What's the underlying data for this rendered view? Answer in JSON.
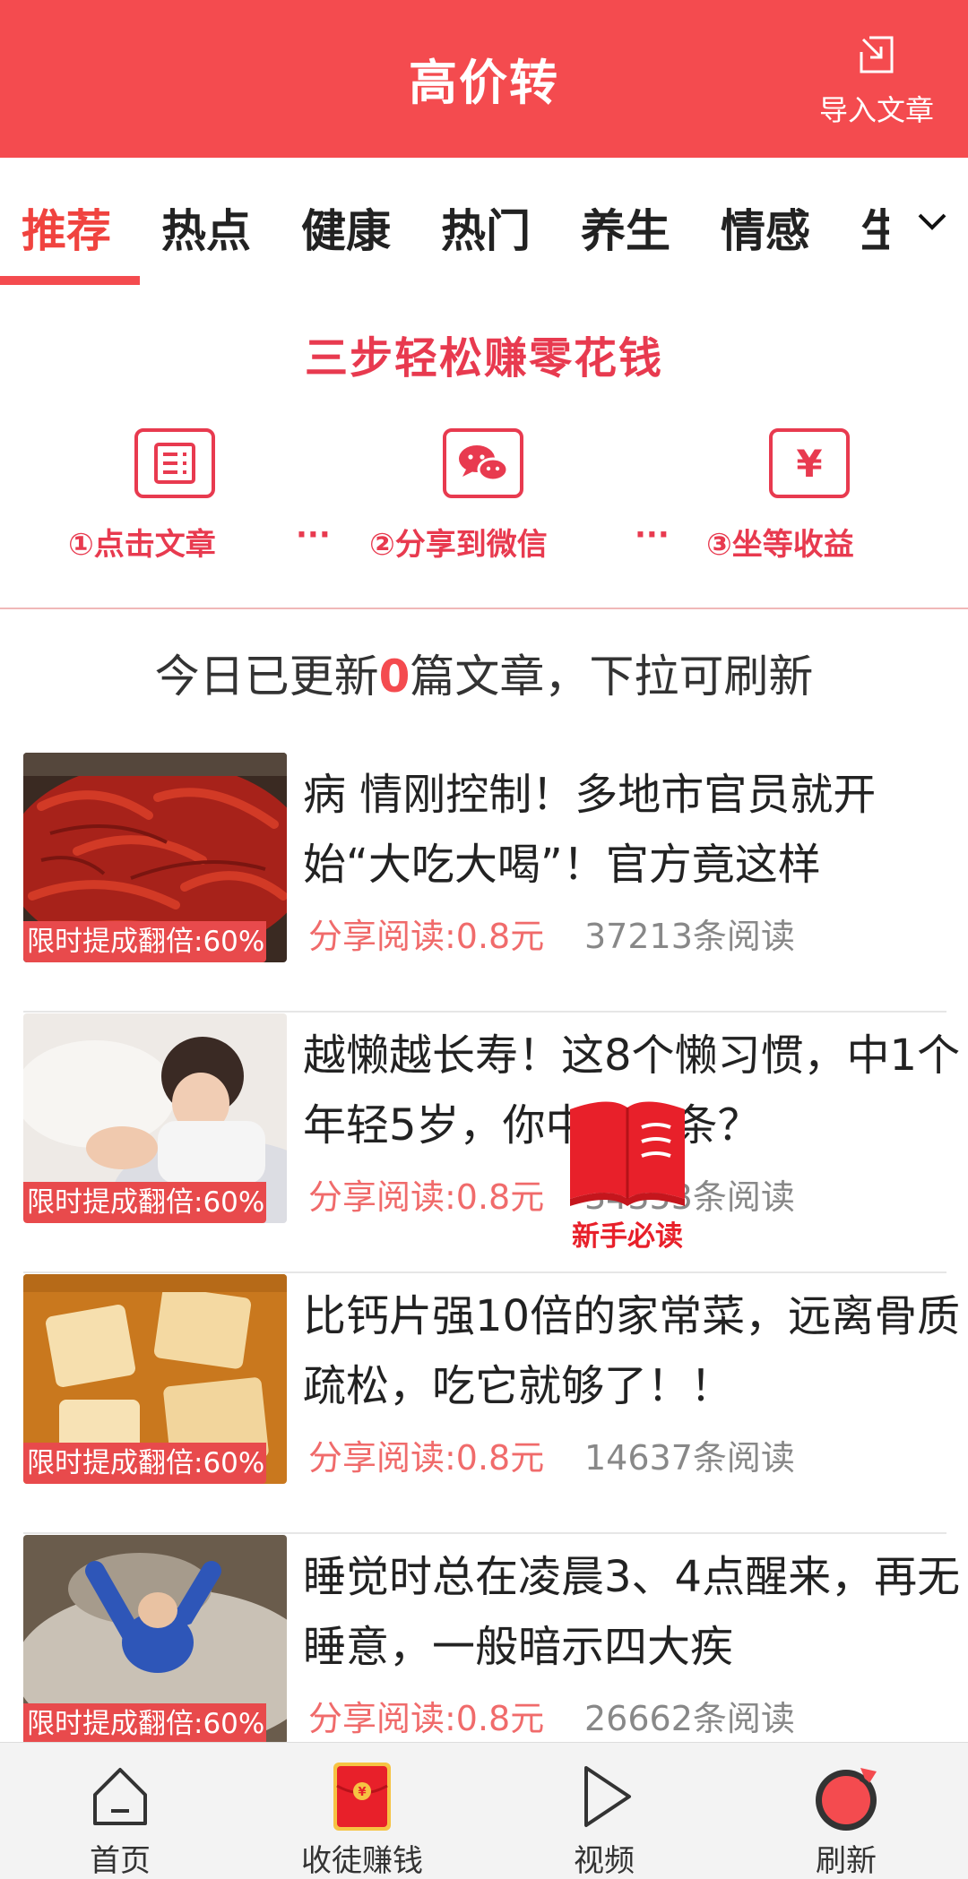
{
  "header": {
    "title": "高价转",
    "import_label": "导入文章"
  },
  "tabs": [
    {
      "label": "推荐",
      "active": true
    },
    {
      "label": "热点",
      "active": false
    },
    {
      "label": "健康",
      "active": false
    },
    {
      "label": "热门",
      "active": false
    },
    {
      "label": "养生",
      "active": false
    },
    {
      "label": "情感",
      "active": false
    },
    {
      "label": "生",
      "active": false
    }
  ],
  "steps": {
    "title": "三步轻松赚零花钱",
    "items": [
      {
        "label": "①点击文章",
        "icon": "article-icon"
      },
      {
        "label": "②分享到微信",
        "icon": "wechat-icon"
      },
      {
        "label": "③坐等收益",
        "icon": "yuan-icon"
      }
    ],
    "separator": "···"
  },
  "notice": {
    "prefix": "今日已更新",
    "count": "0",
    "suffix": "篇文章，下拉可刷新"
  },
  "feed": [
    {
      "title": "病 情刚控制！多地市官员就开始“大吃大喝”！官方竟这样",
      "badge": "限时提成翻倍:60%",
      "price": "分享阅读:0.8元",
      "reads": "37213条阅读",
      "thumb": "crayfish"
    },
    {
      "title": "越懒越长寿！这8个懒习惯，中1个年轻5岁，你中了几条？",
      "badge": "限时提成翻倍:60%",
      "price": "分享阅读:0.8元",
      "reads": "34353条阅读",
      "thumb": "sleeping-woman"
    },
    {
      "title": "比钙片强10倍的家常菜，远离骨质疏松，吃它就够了！！",
      "badge": "限时提成翻倍:60%",
      "price": "分享阅读:0.8元",
      "reads": "14637条阅读",
      "thumb": "tofu"
    },
    {
      "title": "睡觉时总在凌晨3、4点醒来，再无睡意，一般暗示四大疾",
      "badge": "限时提成翻倍:60%",
      "price": "分享阅读:0.8元",
      "reads": "26662条阅读",
      "thumb": "man-in-bed"
    }
  ],
  "guide": {
    "label": "新手必读"
  },
  "bottom_nav": [
    {
      "label": "首页"
    },
    {
      "label": "收徒赚钱"
    },
    {
      "label": "视频"
    },
    {
      "label": "刷新"
    }
  ],
  "colors": {
    "brand_red": "#f44b4f",
    "step_red": "#e83a4f",
    "price_red": "#f06b6b",
    "reads_gray": "#888888"
  }
}
